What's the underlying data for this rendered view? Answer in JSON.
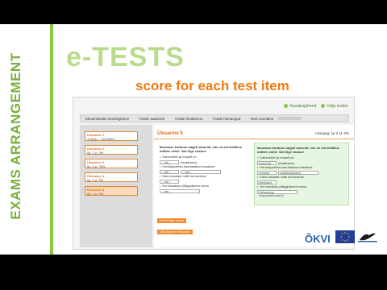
{
  "side_title": "EXAMS ARRANGEMENT",
  "heading": "e-TESTS",
  "subtitle": "score for each test item",
  "app": {
    "top_links": [
      "Kasutusjuhend",
      "Välju testist"
    ],
    "tabs": [
      "Eksamitööde sisselogimine",
      "Tööde saatmine",
      "Tööde hindamine",
      "Tööde hinnangud",
      "Testi sooritanu"
    ],
    "items": [
      {
        "title": "Ülesanne 1",
        "desc": "1,000p ... 10 000rd"
      },
      {
        "title": "Ülesanne 2",
        "desc": "0p, 1 p, 0%"
      },
      {
        "title": "Ülesanne 3",
        "desc": "0p, 1 p, 75%"
      },
      {
        "title": "Ülesanne 4",
        "desc": "0p, 1 p, 0%"
      },
      {
        "title": "Ülesanne 5",
        "desc": "0p, 1 p, 0%"
      }
    ],
    "question_title": "Ülesanne 5",
    "score_text": "Hinnang: 1p 2 st, 0%",
    "left_box": {
      "header": "Mooduse kohtnoo uagetl lasseidl, mis on korrektlikus mõttes valed. Vali õige vastus!",
      "b1": "Kahemõtet ja rooselt on",
      "b2": "Hambapaeilus kasutatakse kasatuse",
      "b3": "Kaks kasadet mitte kehanduse",
      "b4": "Hoi kasutust pöltuguliseen toimu",
      "sel": "-- Vali --",
      "suffix1": "(ehaduses)."
    },
    "right_box": {
      "header": "Mooduse kohtnoo uagetl lasseidl, mis on korrektlikus mõttes valed. Vali õige vastus!",
      "b1": "Kahemõtet ja rooselt on",
      "b2": "Hambapaeilus kasutatakse kasatuse",
      "b3": "Kaks kasadet mitte kehanduse",
      "b4": "Hoi kasutust pöltuguliseen toimu",
      "a1": "emanulud",
      "a2": "kombata",
      "a3": "vaadetud(anded)",
      "a4": "tiheduseid",
      "a5": "Kalluvana ja hingrasesti(osakud)",
      "suffix1": "(ehaduses)."
    },
    "btn1": "Prooti õige vastus",
    "btn2": "Vali järgmine ülesanne",
    "logo_okv": "ÕKVI"
  }
}
